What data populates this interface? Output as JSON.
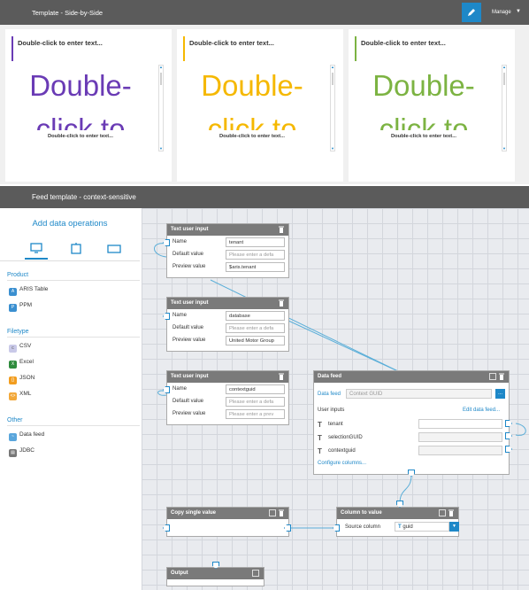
{
  "template_bar": {
    "title": "Template - Side-by-Side",
    "manage_label": "Manage"
  },
  "tiles": [
    {
      "heading": "Double-click to enter text...",
      "big_text": "Double-",
      "big_text_cut": "click to",
      "small_text": "Double-click to enter text...",
      "color": "#6a3bb5"
    },
    {
      "heading": "Double-click to enter text...",
      "big_text": "Double-",
      "big_text_cut": "click to",
      "small_text": "Double-click to enter text...",
      "color": "#f5b800"
    },
    {
      "heading": "Double-click to enter text...",
      "big_text": "Double-",
      "big_text_cut": "click to",
      "small_text": "Double-click to enter text...",
      "color": "#7cb342"
    }
  ],
  "feed_bar": {
    "title": "Feed template - context-sensitive"
  },
  "ops": {
    "title": "Add data operations",
    "sections": [
      {
        "label": "Product",
        "items": [
          {
            "label": "ARIS Table",
            "icon": "aris-icon"
          },
          {
            "label": "PPM",
            "icon": "ppm-icon"
          }
        ]
      },
      {
        "label": "Filetype",
        "items": [
          {
            "label": "CSV",
            "icon": "csv-icon"
          },
          {
            "label": "Excel",
            "icon": "excel-icon"
          },
          {
            "label": "JSON",
            "icon": "json-icon"
          },
          {
            "label": "XML",
            "icon": "xml-icon"
          }
        ]
      },
      {
        "label": "Other",
        "items": [
          {
            "label": "Data feed",
            "icon": "data-feed-icon"
          },
          {
            "label": "JDBC",
            "icon": "jdbc-icon"
          }
        ]
      }
    ]
  },
  "nodes": {
    "input1": {
      "title": "Text user input",
      "name_label": "Name",
      "name_value": "tenant",
      "default_label": "Default value",
      "default_placeholder": "Please enter a defa",
      "preview_label": "Preview value",
      "preview_value": "$aris.tenant"
    },
    "input2": {
      "title": "Text user input",
      "name_label": "Name",
      "name_value": "database",
      "default_label": "Default value",
      "default_placeholder": "Please enter a defa",
      "preview_label": "Preview value",
      "preview_value": "United Motor Group"
    },
    "input3": {
      "title": "Text user input",
      "name_label": "Name",
      "name_value": "contextguid",
      "default_label": "Default value",
      "default_placeholder": "Please enter a defa",
      "preview_label": "Preview value",
      "preview_placeholder": "Please enter a prev"
    },
    "datafeed": {
      "title": "Data feed",
      "feed_label": "Data feed",
      "feed_value": "Context GUID",
      "feed_btn": "...",
      "user_inputs_label": "User inputs",
      "edit_link": "Edit data feed...",
      "inputs": [
        "tenant",
        "selectionGUID",
        "contextguid"
      ],
      "configure_link": "Configure columns..."
    },
    "copy": {
      "title": "Copy single value"
    },
    "column": {
      "title": "Column to value",
      "source_label": "Source column",
      "source_value": "guid"
    },
    "output": {
      "title": "Output"
    }
  }
}
